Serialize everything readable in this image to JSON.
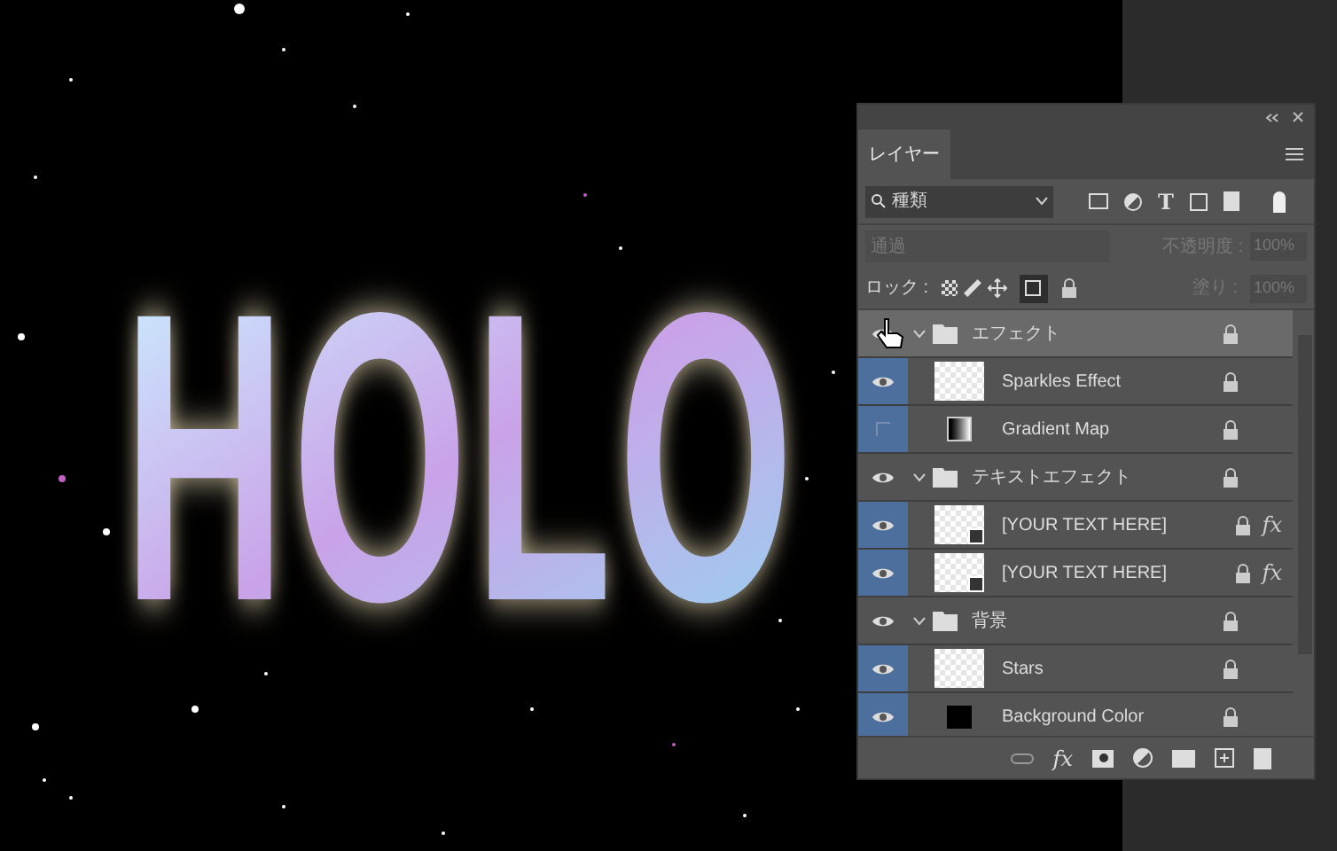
{
  "canvas": {
    "text": "HOLO"
  },
  "toolbar": {
    "effects_button": "fx"
  },
  "type_filter": {
    "label": "T"
  },
  "layers_panel": {
    "tab": {
      "label": "レイヤー",
      "selected": true
    },
    "filter": {
      "value": "種類"
    },
    "blend_mode": {
      "value": "通過",
      "disabled": true
    },
    "opacity": {
      "label": "不透明度 :",
      "value": "100%",
      "disabled": true
    },
    "lock": {
      "label": "ロック :"
    },
    "fill": {
      "label": "塗り :",
      "value": "100%",
      "disabled": true
    },
    "layers": [
      {
        "kind": "group",
        "name": "エフェクト",
        "visible": true,
        "selected": true,
        "expanded": true,
        "children": [
          {
            "kind": "pixel",
            "name": "Sparkles Effect",
            "visible": true,
            "selected": false,
            "eye_highlight": true
          },
          {
            "kind": "adjustment",
            "name": "Gradient Map",
            "visible": false,
            "selected": false,
            "eye_highlight": true
          }
        ]
      },
      {
        "kind": "group",
        "name": "テキストエフェクト",
        "visible": true,
        "selected": false,
        "expanded": true,
        "children": [
          {
            "kind": "smart",
            "name": "[YOUR TEXT HERE]",
            "visible": true,
            "selected": false,
            "eye_highlight": true,
            "fx": "fx"
          },
          {
            "kind": "smart",
            "name": "[YOUR TEXT HERE]",
            "visible": true,
            "selected": false,
            "eye_highlight": true,
            "fx": "fx"
          }
        ]
      },
      {
        "kind": "group",
        "name": "背景",
        "visible": true,
        "selected": false,
        "expanded": true,
        "children": [
          {
            "kind": "pixel",
            "name": "Stars",
            "visible": true,
            "selected": false,
            "eye_highlight": true
          },
          {
            "kind": "fillcolor",
            "name": "Background Color",
            "visible": true,
            "selected": false,
            "eye_highlight": true
          }
        ]
      }
    ]
  }
}
